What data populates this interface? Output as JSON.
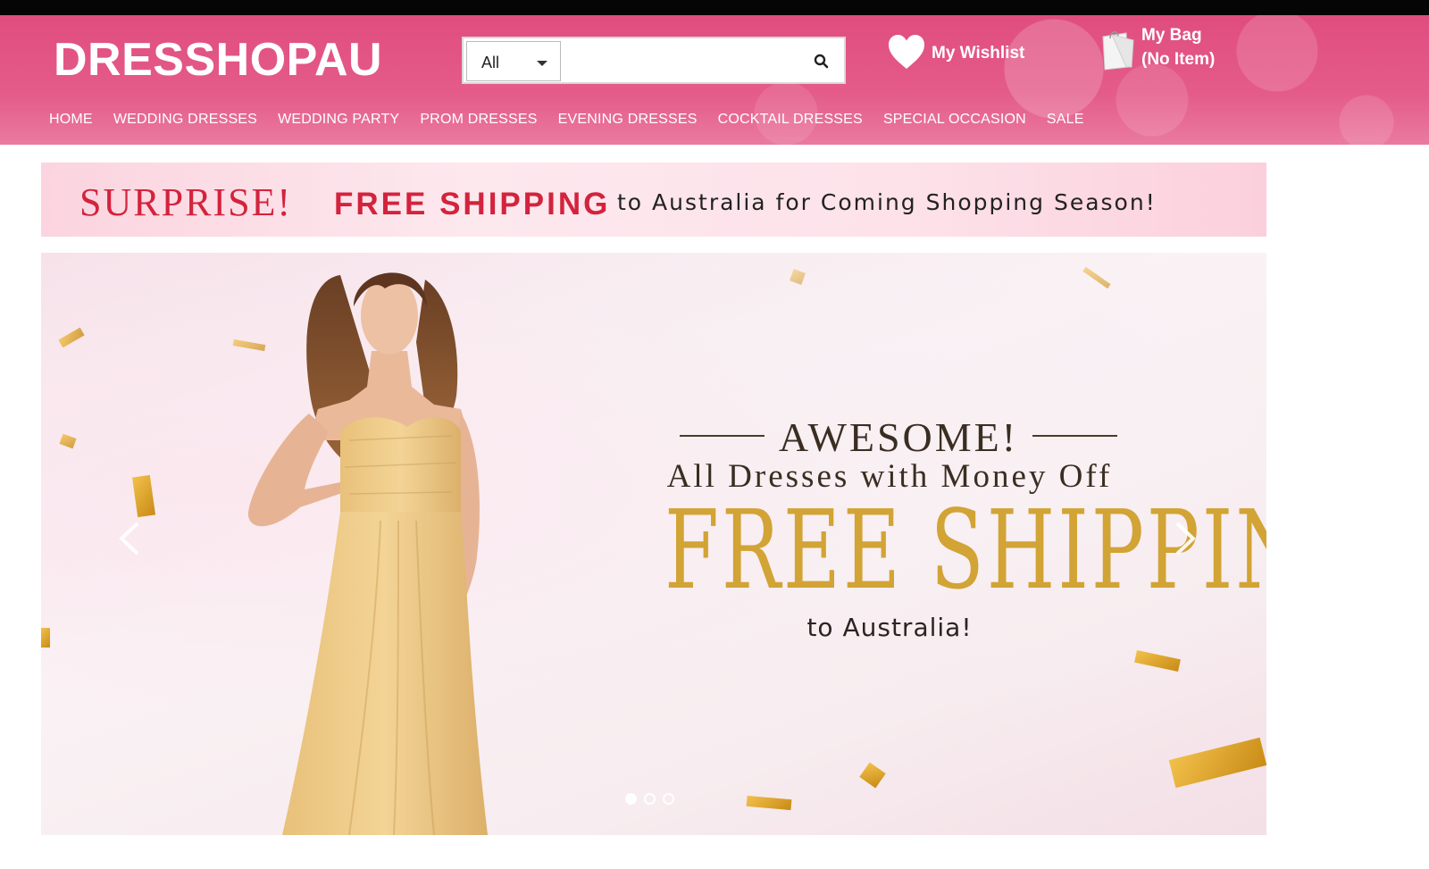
{
  "header": {
    "logo": "DRESSHOPAU",
    "search": {
      "category": "All",
      "placeholder": "",
      "value": ""
    },
    "wishlist_label": "My Wishlist",
    "bag": {
      "title": "My Bag",
      "count": "(No Item)"
    }
  },
  "nav": {
    "items": [
      "HOME",
      "WEDDING DRESSES",
      "WEDDING PARTY",
      "PROM DRESSES",
      "EVENING DRESSES",
      "COCKTAIL DRESSES",
      "SPECIAL OCCASION",
      "SALE"
    ]
  },
  "promo": {
    "surprise": "SURPRISE!",
    "free_shipping": "FREE SHIPPING",
    "rest": "to Australia for Coming Shopping Season!"
  },
  "slide": {
    "headline": "AWESOME!",
    "subline": "All Dresses with Money Off",
    "big": "FREE SHIPPING",
    "footer": "to Australia!",
    "total_slides": 3,
    "active_slide": 1
  },
  "colors": {
    "header_pink": "#e04d7f",
    "promo_red": "#d3233d",
    "gold": "#d2a335"
  }
}
